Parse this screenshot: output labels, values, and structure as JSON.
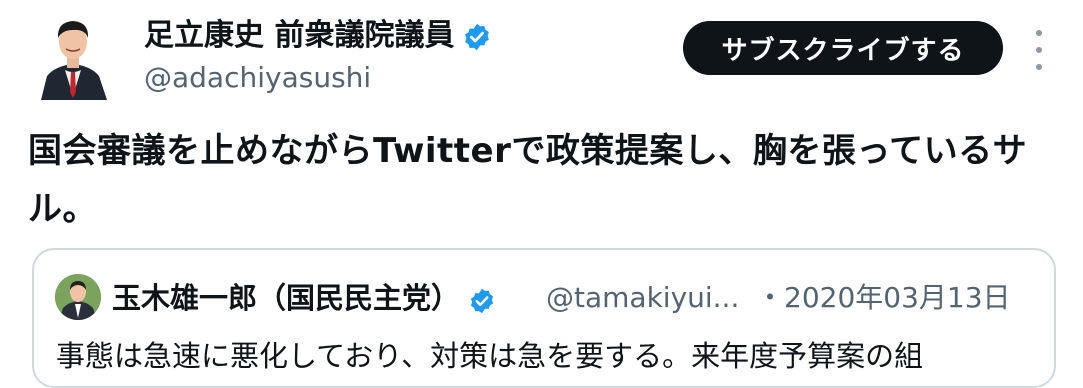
{
  "author": {
    "name": "足立康史 前衆議院議員",
    "handle": "@adachiyasushi",
    "verified": true
  },
  "subscribe_button": {
    "label": "サブスクライブする"
  },
  "tweet": {
    "text": "国会審議を止めながらTwitterで政策提案し、胸を張っているサル。"
  },
  "quoted_tweet": {
    "name": "玉木雄一郎（国民民主党）",
    "handle": "@tamakiyui...",
    "date": "・2020年03月13日",
    "text": "事態は急速に悪化しており、対策は急を要する。来年度予算案の組"
  },
  "icons": {
    "verified": "verified-badge-icon",
    "more": "more-options-icon"
  },
  "colors": {
    "text": "#0f1419",
    "secondary": "#536471",
    "verified": "#1d9bf0",
    "button": "#0f1419",
    "border": "#cfd9de"
  }
}
